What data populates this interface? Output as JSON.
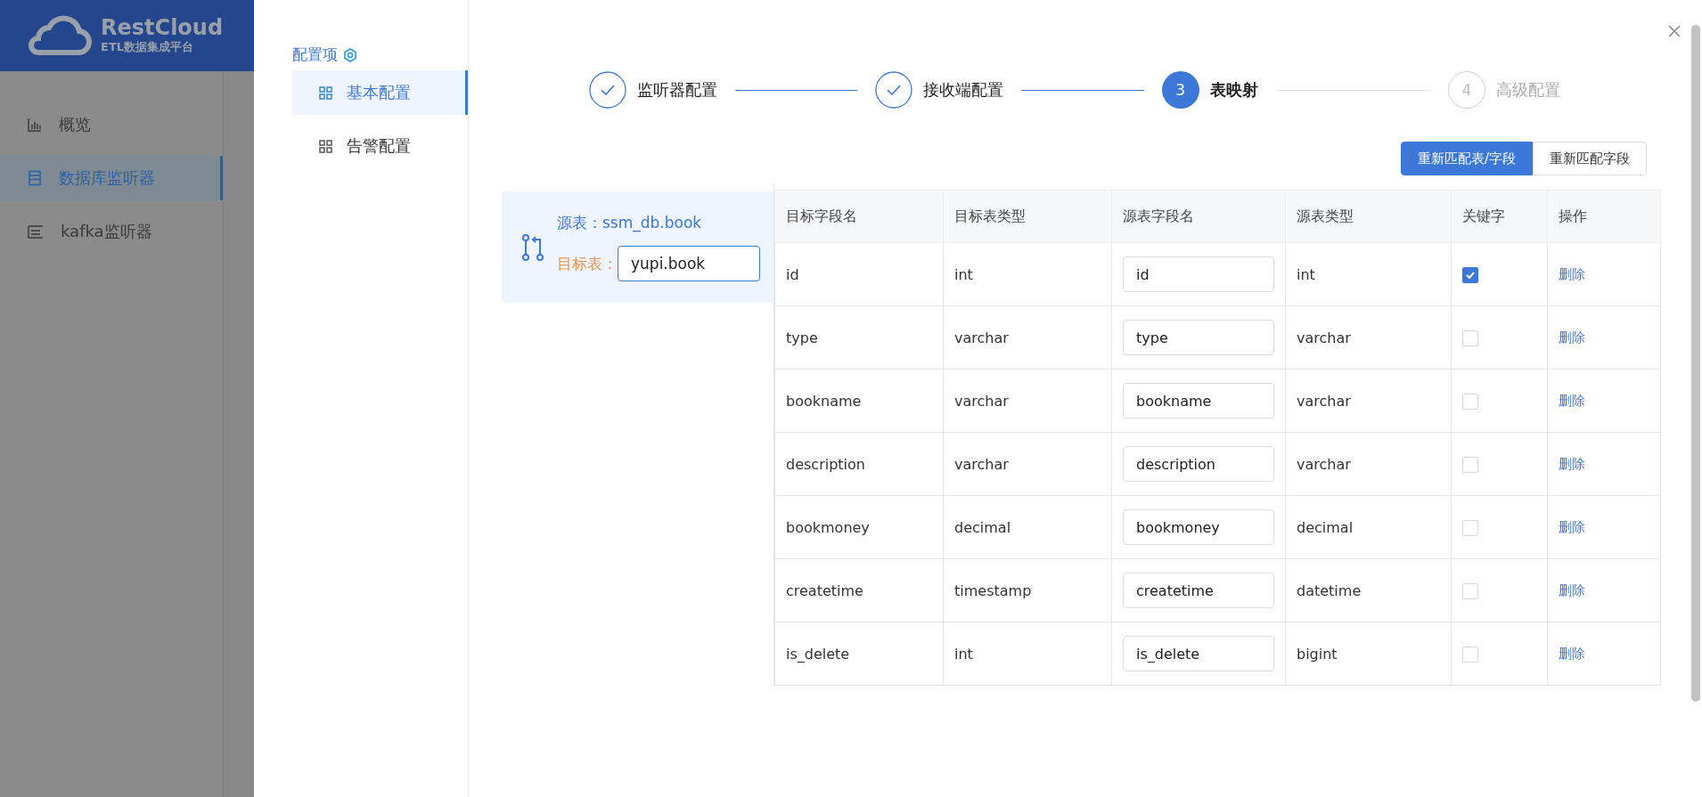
{
  "app_sidebar": {
    "logo": {
      "name": "RestCloud",
      "subtitle": "ETL数据集成平台"
    },
    "items": [
      {
        "label": "概览",
        "selected": false
      },
      {
        "label": "数据库监听器",
        "selected": true
      },
      {
        "label": "kafka监听器",
        "selected": false
      }
    ]
  },
  "config_nav": {
    "title": "配置项",
    "items": [
      {
        "label": "基本配置",
        "selected": true
      },
      {
        "label": "告警配置",
        "selected": false
      }
    ]
  },
  "steps": [
    {
      "label": "监听器配置",
      "completed": true,
      "active": false
    },
    {
      "label": "接收端配置",
      "completed": true,
      "active": false
    },
    {
      "label": "表映射",
      "completed": false,
      "active": true,
      "number": "3"
    },
    {
      "label": "高级配置",
      "completed": false,
      "active": false,
      "number": "4"
    }
  ],
  "buttons": [
    {
      "label": "重新匹配表/字段",
      "kind": "primary"
    },
    {
      "label": "重新匹配字段",
      "kind": "default"
    }
  ],
  "mapping": {
    "source_label": "源表：",
    "source_value": "ssm_db.book",
    "target_label": "目标表：",
    "target_value": "yupi.book"
  },
  "table": {
    "columns": [
      "目标字段名",
      "目标表类型",
      "源表字段名",
      "源表类型",
      "关键字",
      "操作"
    ],
    "rows": [
      {
        "target_field": "id",
        "target_type": "int",
        "source_field": "id",
        "source_type": "int",
        "key": true,
        "action": "删除"
      },
      {
        "target_field": "type",
        "target_type": "varchar",
        "source_field": "type",
        "source_type": "varchar",
        "key": false,
        "action": "删除"
      },
      {
        "target_field": "bookname",
        "target_type": "varchar",
        "source_field": "bookname",
        "source_type": "varchar",
        "key": false,
        "action": "删除"
      },
      {
        "target_field": "description",
        "target_type": "varchar",
        "source_field": "description",
        "source_type": "varchar",
        "key": false,
        "action": "删除"
      },
      {
        "target_field": "bookmoney",
        "target_type": "decimal",
        "source_field": "bookmoney",
        "source_type": "decimal",
        "key": false,
        "action": "删除"
      },
      {
        "target_field": "createtime",
        "target_type": "timestamp",
        "source_field": "createtime",
        "source_type": "datetime",
        "key": false,
        "action": "删除"
      },
      {
        "target_field": "is_delete",
        "target_type": "int",
        "source_field": "is_delete",
        "source_type": "bigint",
        "key": false,
        "action": "删除"
      }
    ]
  }
}
